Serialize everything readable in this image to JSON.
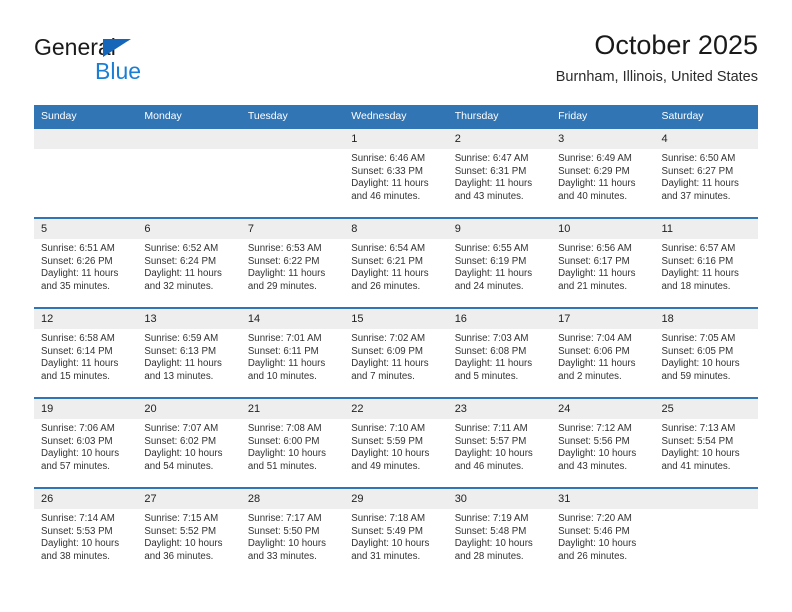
{
  "brand": {
    "name_top": "General",
    "name_bottom": "Blue",
    "triangle_color": "#1565b8",
    "blue_color": "#1a7fd4"
  },
  "header": {
    "title": "October 2025",
    "subtitle": "Burnham, Illinois, United States"
  },
  "theme": {
    "header_bg": "#3175b5",
    "daynum_bg": "#eeeeee",
    "row_border": "#3175b5"
  },
  "weekdays": [
    "Sunday",
    "Monday",
    "Tuesday",
    "Wednesday",
    "Thursday",
    "Friday",
    "Saturday"
  ],
  "weeks": [
    [
      {
        "day": "",
        "empty": true
      },
      {
        "day": "",
        "empty": true
      },
      {
        "day": "",
        "empty": true
      },
      {
        "day": "1",
        "sunrise": "Sunrise: 6:46 AM",
        "sunset": "Sunset: 6:33 PM",
        "daylight": "Daylight: 11 hours and 46 minutes."
      },
      {
        "day": "2",
        "sunrise": "Sunrise: 6:47 AM",
        "sunset": "Sunset: 6:31 PM",
        "daylight": "Daylight: 11 hours and 43 minutes."
      },
      {
        "day": "3",
        "sunrise": "Sunrise: 6:49 AM",
        "sunset": "Sunset: 6:29 PM",
        "daylight": "Daylight: 11 hours and 40 minutes."
      },
      {
        "day": "4",
        "sunrise": "Sunrise: 6:50 AM",
        "sunset": "Sunset: 6:27 PM",
        "daylight": "Daylight: 11 hours and 37 minutes."
      }
    ],
    [
      {
        "day": "5",
        "sunrise": "Sunrise: 6:51 AM",
        "sunset": "Sunset: 6:26 PM",
        "daylight": "Daylight: 11 hours and 35 minutes."
      },
      {
        "day": "6",
        "sunrise": "Sunrise: 6:52 AM",
        "sunset": "Sunset: 6:24 PM",
        "daylight": "Daylight: 11 hours and 32 minutes."
      },
      {
        "day": "7",
        "sunrise": "Sunrise: 6:53 AM",
        "sunset": "Sunset: 6:22 PM",
        "daylight": "Daylight: 11 hours and 29 minutes."
      },
      {
        "day": "8",
        "sunrise": "Sunrise: 6:54 AM",
        "sunset": "Sunset: 6:21 PM",
        "daylight": "Daylight: 11 hours and 26 minutes."
      },
      {
        "day": "9",
        "sunrise": "Sunrise: 6:55 AM",
        "sunset": "Sunset: 6:19 PM",
        "daylight": "Daylight: 11 hours and 24 minutes."
      },
      {
        "day": "10",
        "sunrise": "Sunrise: 6:56 AM",
        "sunset": "Sunset: 6:17 PM",
        "daylight": "Daylight: 11 hours and 21 minutes."
      },
      {
        "day": "11",
        "sunrise": "Sunrise: 6:57 AM",
        "sunset": "Sunset: 6:16 PM",
        "daylight": "Daylight: 11 hours and 18 minutes."
      }
    ],
    [
      {
        "day": "12",
        "sunrise": "Sunrise: 6:58 AM",
        "sunset": "Sunset: 6:14 PM",
        "daylight": "Daylight: 11 hours and 15 minutes."
      },
      {
        "day": "13",
        "sunrise": "Sunrise: 6:59 AM",
        "sunset": "Sunset: 6:13 PM",
        "daylight": "Daylight: 11 hours and 13 minutes."
      },
      {
        "day": "14",
        "sunrise": "Sunrise: 7:01 AM",
        "sunset": "Sunset: 6:11 PM",
        "daylight": "Daylight: 11 hours and 10 minutes."
      },
      {
        "day": "15",
        "sunrise": "Sunrise: 7:02 AM",
        "sunset": "Sunset: 6:09 PM",
        "daylight": "Daylight: 11 hours and 7 minutes."
      },
      {
        "day": "16",
        "sunrise": "Sunrise: 7:03 AM",
        "sunset": "Sunset: 6:08 PM",
        "daylight": "Daylight: 11 hours and 5 minutes."
      },
      {
        "day": "17",
        "sunrise": "Sunrise: 7:04 AM",
        "sunset": "Sunset: 6:06 PM",
        "daylight": "Daylight: 11 hours and 2 minutes."
      },
      {
        "day": "18",
        "sunrise": "Sunrise: 7:05 AM",
        "sunset": "Sunset: 6:05 PM",
        "daylight": "Daylight: 10 hours and 59 minutes."
      }
    ],
    [
      {
        "day": "19",
        "sunrise": "Sunrise: 7:06 AM",
        "sunset": "Sunset: 6:03 PM",
        "daylight": "Daylight: 10 hours and 57 minutes."
      },
      {
        "day": "20",
        "sunrise": "Sunrise: 7:07 AM",
        "sunset": "Sunset: 6:02 PM",
        "daylight": "Daylight: 10 hours and 54 minutes."
      },
      {
        "day": "21",
        "sunrise": "Sunrise: 7:08 AM",
        "sunset": "Sunset: 6:00 PM",
        "daylight": "Daylight: 10 hours and 51 minutes."
      },
      {
        "day": "22",
        "sunrise": "Sunrise: 7:10 AM",
        "sunset": "Sunset: 5:59 PM",
        "daylight": "Daylight: 10 hours and 49 minutes."
      },
      {
        "day": "23",
        "sunrise": "Sunrise: 7:11 AM",
        "sunset": "Sunset: 5:57 PM",
        "daylight": "Daylight: 10 hours and 46 minutes."
      },
      {
        "day": "24",
        "sunrise": "Sunrise: 7:12 AM",
        "sunset": "Sunset: 5:56 PM",
        "daylight": "Daylight: 10 hours and 43 minutes."
      },
      {
        "day": "25",
        "sunrise": "Sunrise: 7:13 AM",
        "sunset": "Sunset: 5:54 PM",
        "daylight": "Daylight: 10 hours and 41 minutes."
      }
    ],
    [
      {
        "day": "26",
        "sunrise": "Sunrise: 7:14 AM",
        "sunset": "Sunset: 5:53 PM",
        "daylight": "Daylight: 10 hours and 38 minutes."
      },
      {
        "day": "27",
        "sunrise": "Sunrise: 7:15 AM",
        "sunset": "Sunset: 5:52 PM",
        "daylight": "Daylight: 10 hours and 36 minutes."
      },
      {
        "day": "28",
        "sunrise": "Sunrise: 7:17 AM",
        "sunset": "Sunset: 5:50 PM",
        "daylight": "Daylight: 10 hours and 33 minutes."
      },
      {
        "day": "29",
        "sunrise": "Sunrise: 7:18 AM",
        "sunset": "Sunset: 5:49 PM",
        "daylight": "Daylight: 10 hours and 31 minutes."
      },
      {
        "day": "30",
        "sunrise": "Sunrise: 7:19 AM",
        "sunset": "Sunset: 5:48 PM",
        "daylight": "Daylight: 10 hours and 28 minutes."
      },
      {
        "day": "31",
        "sunrise": "Sunrise: 7:20 AM",
        "sunset": "Sunset: 5:46 PM",
        "daylight": "Daylight: 10 hours and 26 minutes."
      },
      {
        "day": "",
        "empty": true
      }
    ]
  ]
}
